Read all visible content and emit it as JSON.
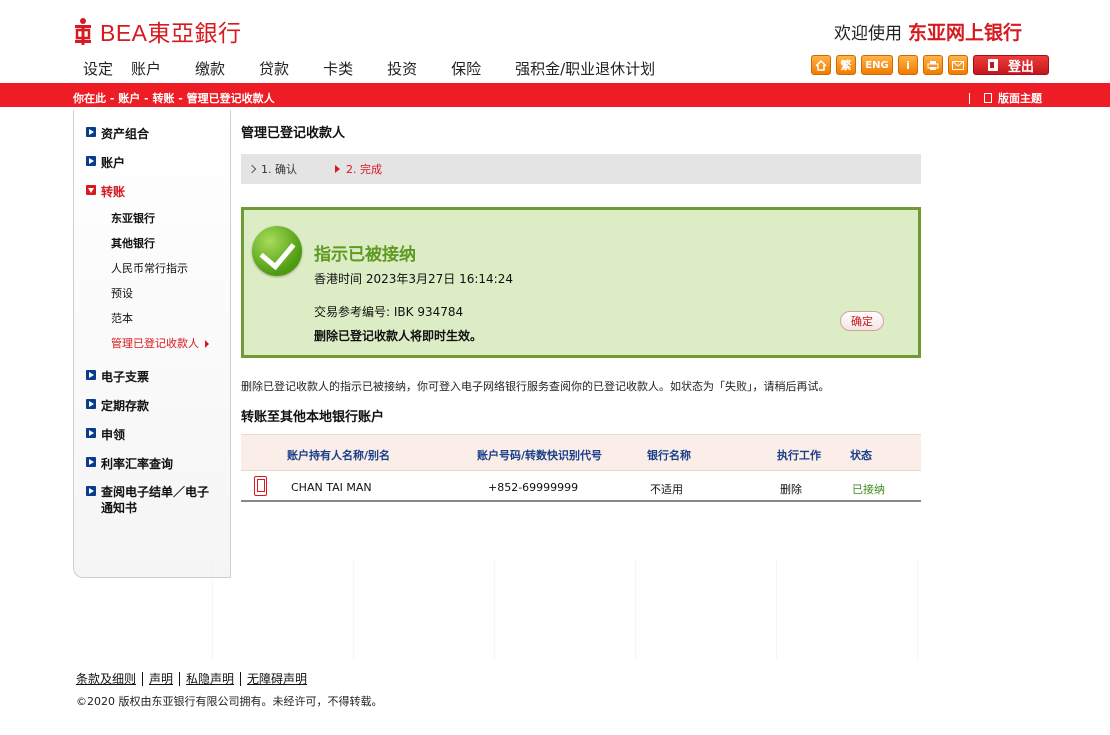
{
  "header": {
    "logo_text": "BEA東亞銀行",
    "welcome_prefix": "欢迎使用",
    "welcome_brand": "东亚网上银行"
  },
  "nav": [
    "设定",
    "账户",
    "缴款",
    "贷款",
    "卡类",
    "投资",
    "保险",
    "强积金/职业退休计划"
  ],
  "tools": {
    "trad": "繁",
    "eng": "ENG",
    "info": "i",
    "logout_label": "登出"
  },
  "breadcrumb": "你在此 - 账户  - 转账 - 管理已登记收款人",
  "theme_label": "版面主题",
  "sidebar": {
    "items": [
      "资产组合",
      "账户",
      "转账",
      "电子支票",
      "定期存款",
      "申领",
      "利率汇率查询",
      "查阅电子结单／电子通知书"
    ],
    "sub_items": [
      "东亚银行",
      "其他银行",
      "人民币常行指示",
      "预设",
      "范本",
      "管理已登记收款人"
    ]
  },
  "main": {
    "title": "管理已登记收款人",
    "steps": [
      "1. 确认",
      "2. 完成"
    ],
    "success": {
      "title": "指示已被接纳",
      "time": "香港时间 2023年3月27日 16:14:24",
      "ref": "交易参考编号: IBK 934784",
      "note": "删除已登记收款人将即时生效。",
      "ok_button": "确定"
    },
    "info_text": "删除已登记收款人的指示已被接纳，你可登入电子网络银行服务查阅你的已登记收款人。如状态为「失败」，请稍后再试。",
    "section_title": "转账至其他本地银行账户",
    "table": {
      "headers": [
        "账户持有人名称/别名",
        "账户号码/转数快识别代号",
        "银行名称",
        "执行工作",
        "状态"
      ],
      "rows": [
        {
          "name": "CHAN TAI MAN",
          "account": "+852-69999999",
          "bank": "不适用",
          "action": "删除",
          "status": "已接纳"
        }
      ]
    }
  },
  "footer": {
    "links": [
      "条款及细则",
      "声明",
      "私隐声明",
      "无障碍声明"
    ],
    "copyright": "©2020 版权由东亚银行有限公司拥有。未经许可，不得转载。"
  },
  "colors": {
    "brand_red": "#ee1c25",
    "success_green": "#5f9a22",
    "nav_blue": "#0b3c8c"
  }
}
